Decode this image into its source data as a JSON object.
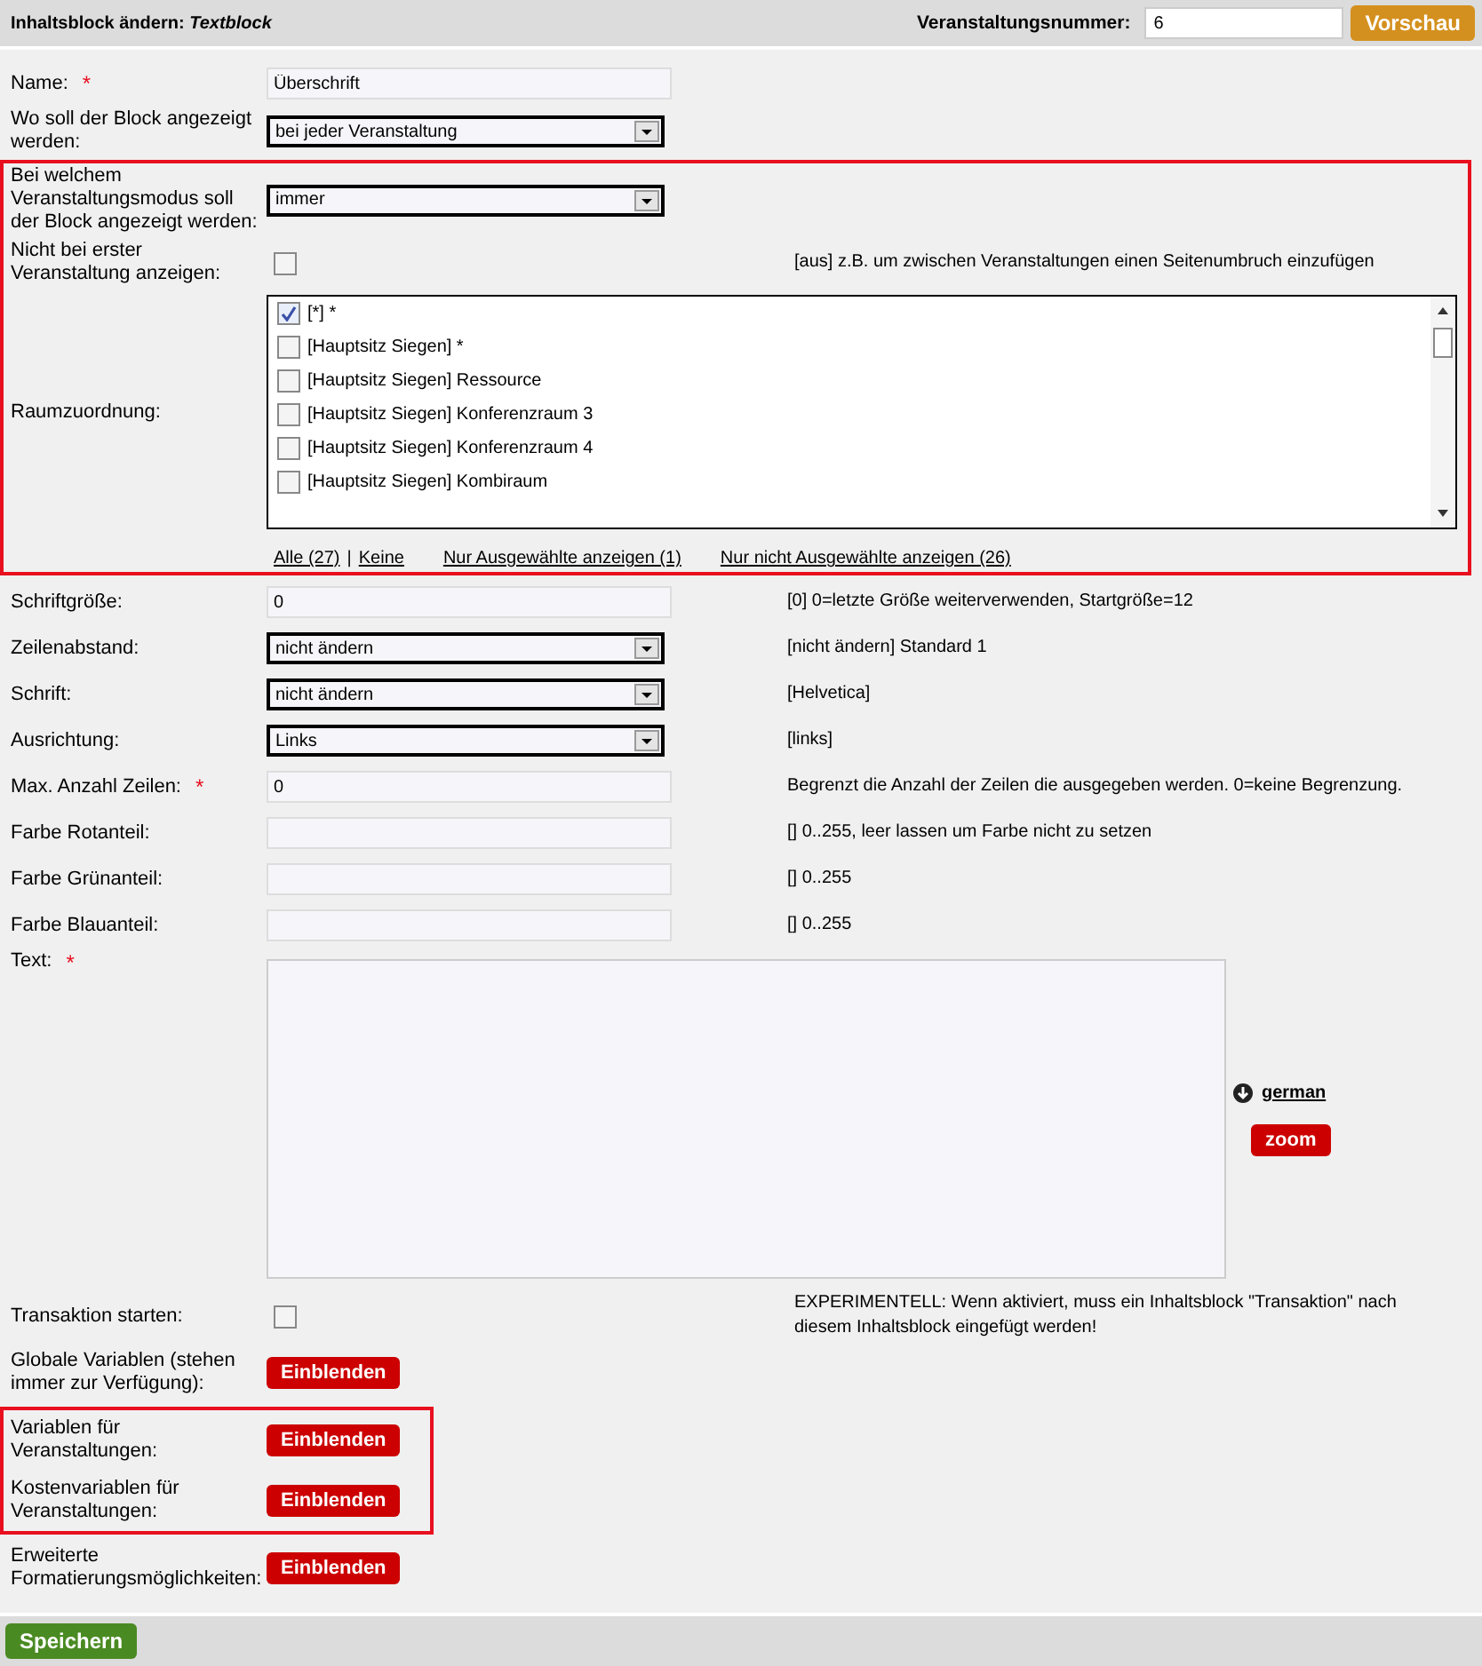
{
  "header": {
    "title": "Inhaltsblock ändern: *Textblock*",
    "event_number_label": "Veranstaltungsnummer:",
    "event_number_value": "6",
    "preview_button": "Vorschau"
  },
  "sections": [
    {
      "fields": [
        {
          "kind": "input",
          "label": "Name:",
          "required_mark": "*",
          "value": "Überschrift"
        },
        {
          "kind": "select",
          "label": "Wo soll der Block angezeigt werden:",
          "value": "bei jeder Veranstaltung"
        }
      ]
    },
    {
      "highlighted": true,
      "fields": [
        {
          "kind": "select",
          "label": "Bei welchem Veranstaltungsmodus soll der Block angezeigt werden:",
          "value": "immer"
        },
        {
          "kind": "checkbox",
          "label": "Nicht bei erster Veranstaltung anzeigen:",
          "checked": false,
          "hint": "[aus] z.B. um zwischen Veranstaltungen einen Seitenumbruch einzufügen"
        },
        {
          "kind": "rooms",
          "label": "Raumzuordnung:",
          "items": [
            {
              "label": "[*] *",
              "checked": true
            },
            {
              "label": "[Hauptsitz Siegen] *",
              "checked": false
            },
            {
              "label": "[Hauptsitz Siegen] Ressource",
              "checked": false
            },
            {
              "label": "[Hauptsitz Siegen] Konferenzraum 3",
              "checked": false
            },
            {
              "label": "[Hauptsitz Siegen] Konferenzraum 4",
              "checked": false
            },
            {
              "label": "[Hauptsitz Siegen] Kombiraum",
              "checked": false
            }
          ],
          "links": [
            {
              "kind": "link",
              "text": "Alle (27)"
            },
            {
              "kind": "separator",
              "text": "|"
            },
            {
              "kind": "link",
              "text": "Keine"
            },
            {
              "kind": "gap"
            },
            {
              "kind": "link",
              "text": "Nur Ausgewählte anzeigen (1)"
            },
            {
              "kind": "gap"
            },
            {
              "kind": "link",
              "text": "Nur nicht Ausgewählte anzeigen (26)"
            }
          ]
        }
      ]
    },
    {
      "fields": [
        {
          "kind": "input",
          "label": "Schriftgröße:",
          "value": "0",
          "hint": "[0] 0=letzte Größe weiterverwenden, Startgröße=12"
        },
        {
          "kind": "select",
          "label": "Zeilenabstand:",
          "value": "nicht ändern",
          "hint": "[nicht ändern] Standard 1"
        },
        {
          "kind": "select",
          "label": "Schrift:",
          "value": "nicht ändern",
          "hint": "[Helvetica]"
        },
        {
          "kind": "select",
          "label": "Ausrichtung:",
          "value": "Links",
          "hint": "[links]"
        },
        {
          "kind": "input",
          "label": "Max. Anzahl Zeilen:",
          "required_mark": "*",
          "value": "0",
          "hint": "Begrenzt die Anzahl der Zeilen die ausgegeben werden. 0=keine Begrenzung."
        },
        {
          "kind": "input",
          "label": "Farbe Rotanteil:",
          "hint": "[] 0..255, leer lassen um Farbe nicht zu setzen"
        },
        {
          "kind": "input",
          "label": "Farbe Grünanteil:",
          "hint": "[] 0..255"
        },
        {
          "kind": "input",
          "label": "Farbe Blauanteil:",
          "hint": "[] 0..255"
        },
        {
          "kind": "textarea",
          "label": "Text:",
          "required_mark": "*",
          "language_link": "german",
          "zoom_button": "zoom"
        },
        {
          "kind": "checkbox",
          "label": "Transaktion starten:",
          "checked": false,
          "hint": "EXPERIMENTELL: Wenn aktiviert, muss ein Inhaltsblock \"Transaktion\" nach diesem Inhaltsblock eingefügt werden!"
        },
        {
          "kind": "button",
          "label": "Globale Variablen (stehen immer zur Verfügung):",
          "button": "Einblenden"
        }
      ]
    },
    {
      "highlighted": true,
      "fields": [
        {
          "kind": "button",
          "label": "Variablen für Veranstaltungen:",
          "button": "Einblenden"
        },
        {
          "kind": "button",
          "label": "Kostenvariablen für Veranstaltungen:",
          "button": "Einblenden"
        }
      ]
    },
    {
      "fields": [
        {
          "kind": "button",
          "label": "Erweiterte Formatierungsmöglichkeiten:",
          "button": "Einblenden"
        }
      ]
    }
  ],
  "footer": {
    "save_button": "Speichern"
  }
}
